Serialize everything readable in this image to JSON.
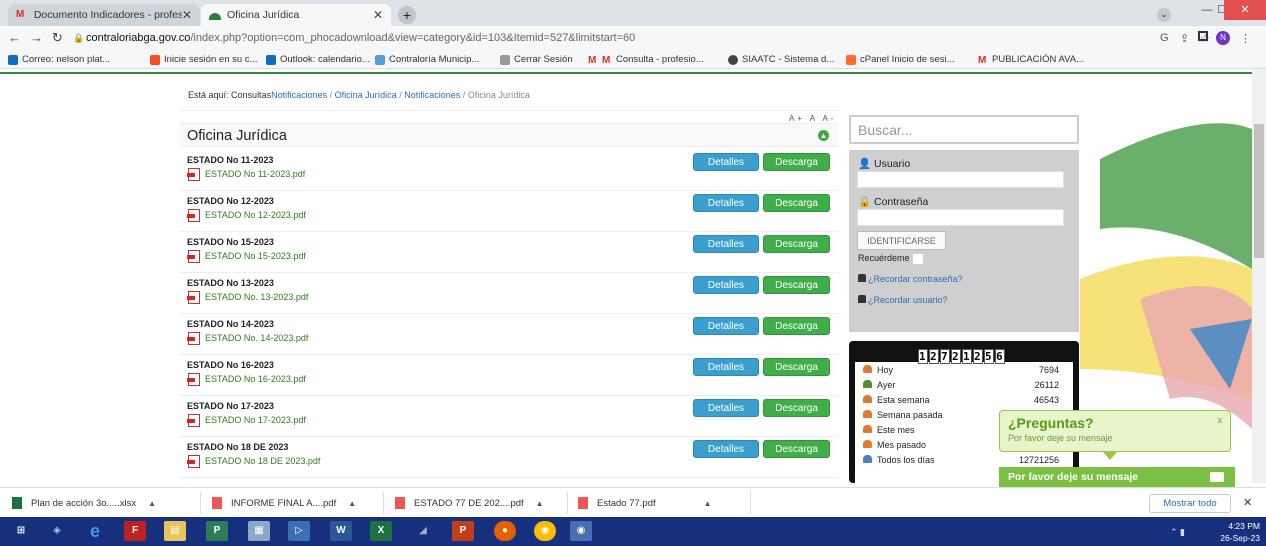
{
  "browser": {
    "tabs": [
      {
        "label": "Documento Indicadores - profes",
        "active": false
      },
      {
        "label": "Oficina Jurídica",
        "active": true
      }
    ],
    "url_domain": "contraloriabga.gov.co",
    "url_path": "/index.php?option=com_phocadownload&view=category&id=103&Itemid=527&limitstart=60",
    "avatar_letter": "N",
    "bookmarks": [
      "Correo: nelson plat...",
      "Inicie sesión en su c...",
      "Outlook: calendario...",
      "Contraloría Municip...",
      "Cerrar Sesión",
      "Consulta - profesio...",
      "SIAATC - Sistema d...",
      "cPanel Inicio de sesi...",
      "PUBLICACIÓN AVA..."
    ]
  },
  "breadcrumb": {
    "prefix": "Está aquí:",
    "first": "Consultas",
    "items": [
      "Notificaciones",
      "Oficina Jurídica",
      "Notificaciones"
    ],
    "current": "Oficina Jurídica",
    "sep": "/"
  },
  "font_controls": "A+ A A-",
  "category": {
    "title": "Oficina Jurídica"
  },
  "buttons": {
    "details": "Detalles",
    "download": "Descarga"
  },
  "documents": [
    {
      "title": "ESTADO No 11-2023",
      "file": "ESTADO No 11-2023.pdf"
    },
    {
      "title": "ESTADO No 12-2023",
      "file": "ESTADO No 12-2023.pdf"
    },
    {
      "title": "ESTADO No 15-2023",
      "file": "ESTADO No 15-2023.pdf"
    },
    {
      "title": "ESTADO No 13-2023",
      "file": "ESTADO No. 13-2023.pdf"
    },
    {
      "title": "ESTADO No 14-2023",
      "file": "ESTADO No. 14-2023.pdf"
    },
    {
      "title": "ESTADO No 16-2023",
      "file": "ESTADO No 16-2023.pdf"
    },
    {
      "title": "ESTADO No 17-2023",
      "file": "ESTADO No 17-2023.pdf"
    },
    {
      "title": "ESTADO No 18 DE 2023",
      "file": "ESTADO No 18 DE 2023.pdf"
    }
  ],
  "search": {
    "placeholder": "Buscar..."
  },
  "login": {
    "user_label": "Usuario",
    "password_label": "Contraseña",
    "submit": "IDENTIFICARSE",
    "remember": "Recuérdeme",
    "forgot_password": "¿Recordar contraseña?",
    "forgot_user": "¿Recordar usuario?"
  },
  "counter": {
    "digits": [
      "1",
      "2",
      "7",
      "2",
      "1",
      "2",
      "5",
      "6"
    ],
    "stats": [
      {
        "label": "Hoy",
        "value": "7694"
      },
      {
        "label": "Ayer",
        "value": "26112"
      },
      {
        "label": "Esta semana",
        "value": "46543"
      },
      {
        "label": "Semana pasada",
        "value": ""
      },
      {
        "label": "Este mes",
        "value": ""
      },
      {
        "label": "Mes pasado",
        "value": ""
      },
      {
        "label": "Todos los días",
        "value": "12721256"
      }
    ]
  },
  "chat": {
    "question": "¿Preguntas?",
    "subtitle": "Por favor deje su mensaje",
    "close": "x",
    "bar_label": "Por favor deje su mensaje"
  },
  "downloads": [
    "Plan de acción 3o.....xlsx",
    "INFORME FINAL A....pdf",
    "ESTADO 77 DE 202....pdf",
    "Estado 77.pdf"
  ],
  "downloads_show_all": "Mostrar todo",
  "clock": {
    "time": "4:23 PM",
    "date": "26-Sep-23"
  },
  "colors": {
    "details_button": "#3a9fcf",
    "download_button": "#3fae49",
    "file_link": "#2f7d1d",
    "taskbar": "#17307e"
  }
}
